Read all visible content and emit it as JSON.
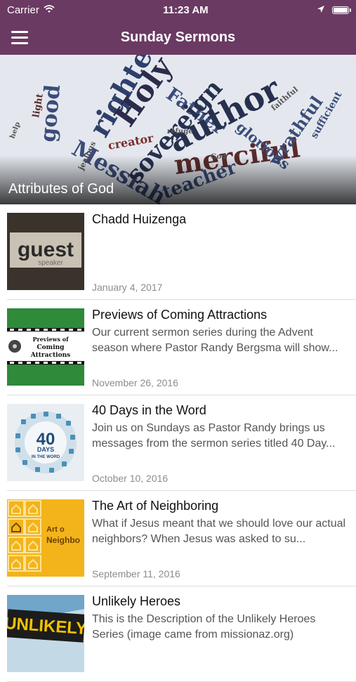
{
  "status_bar": {
    "carrier": "Carrier",
    "time": "11:23 AM",
    "icons": [
      "wifi-icon",
      "location-arrow-icon",
      "battery-icon"
    ]
  },
  "navbar": {
    "title": "Sunday Sermons",
    "menu_icon": "hamburger-menu-icon",
    "color": "#6b3a63"
  },
  "hero": {
    "title": "Attributes of God",
    "words": [
      "righteous",
      "Holy",
      "Father",
      "author",
      "merciful",
      "Messiah",
      "sovereign",
      "good",
      "glorious",
      "wrathful",
      "creator",
      "teacher",
      "light",
      "sufficient",
      "refuge",
      "God",
      "help",
      "jealous",
      "faithful"
    ]
  },
  "sermons": [
    {
      "title": "Chadd Huizenga",
      "description": "",
      "date": "January 4, 2017",
      "thumbnail": {
        "main": "guest",
        "sub": "speaker"
      }
    },
    {
      "title": "Previews of Coming Attractions",
      "description": "Our current sermon series during the Advent season where Pastor Randy Bergsma will show...",
      "date": "November 26, 2016",
      "thumbnail": {
        "line1": "Previews of",
        "line2": "Coming",
        "line3": "Attractions"
      }
    },
    {
      "title": "40 Days in the Word",
      "description": "Join us on Sundays as Pastor Randy brings us messages from the sermon series titled 40 Day...",
      "date": "October 10, 2016",
      "thumbnail": {
        "number": "40",
        "word": "DAYS",
        "sub": "IN THE WORD"
      }
    },
    {
      "title": "The Art of Neighboring",
      "description": "What if Jesus meant that we should love our actual neighbors? When Jesus was asked to su...",
      "date": "September 11, 2016",
      "thumbnail": {
        "line1": "Art o",
        "line2": "Neighbo"
      }
    },
    {
      "title": "Unlikely Heroes",
      "description": "This is the Description of the Unlikely Heroes Series (image came from missionaz.org)",
      "date": "",
      "thumbnail": {
        "text": "UNLIKELY"
      }
    }
  ]
}
